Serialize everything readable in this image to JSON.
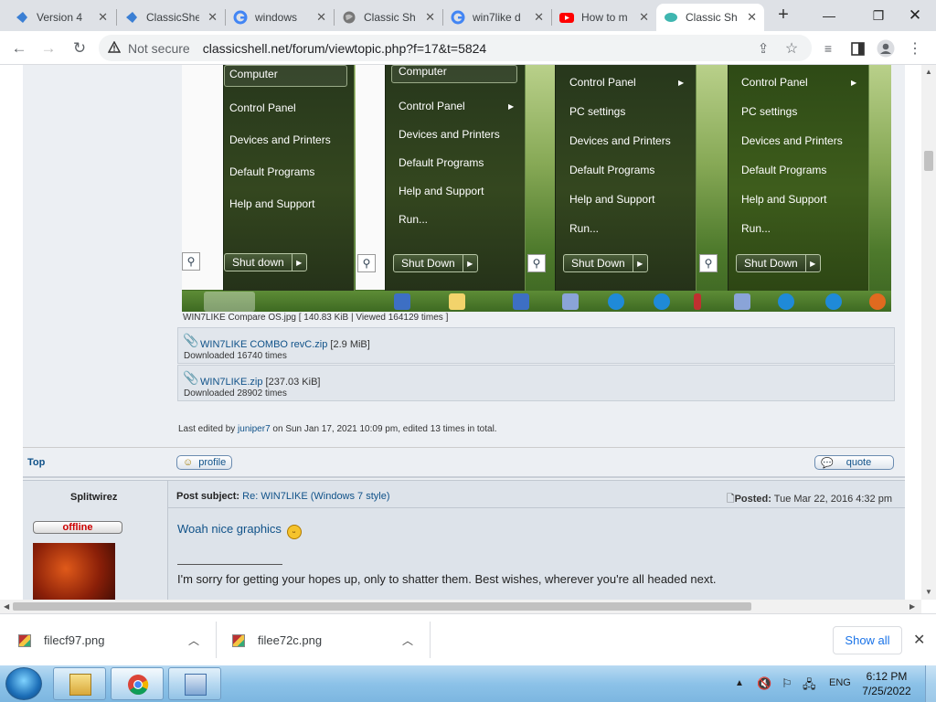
{
  "browser": {
    "tabs": [
      {
        "title": "Version 4",
        "icon": "classicshell-icon",
        "color": "#3b7fd4"
      },
      {
        "title": "ClassicShe",
        "icon": "classicshell-icon",
        "color": "#3b7fd4"
      },
      {
        "title": "windows",
        "icon": "google-icon",
        "color": "#4285f4"
      },
      {
        "title": "Classic Sh",
        "icon": "globe-icon",
        "color": "#666666"
      },
      {
        "title": "win7like d",
        "icon": "google-icon",
        "color": "#4285f4"
      },
      {
        "title": "How to m",
        "icon": "youtube-icon",
        "color": "#ff0000"
      },
      {
        "title": "Classic Sh",
        "icon": "classicshell-icon",
        "color": "#3fb6b0"
      }
    ],
    "security": "Not secure",
    "url": "classicshell.net/forum/viewtopic.php?f=17&t=5824"
  },
  "screenshot": {
    "menus": [
      {
        "items": [
          "Computer",
          "Control Panel",
          "Devices and Printers",
          "Default Programs",
          "Help and Support"
        ],
        "shutdown": "Shut down"
      },
      {
        "items": [
          "Computer",
          "Control Panel",
          "Devices and Printers",
          "Default Programs",
          "Help and Support",
          "Run..."
        ],
        "shutdown": "Shut Down"
      },
      {
        "items": [
          "Control Panel",
          "PC settings",
          "Devices and Printers",
          "Default Programs",
          "Help and Support",
          "Run..."
        ],
        "shutdown": "Shut Down"
      },
      {
        "items": [
          "Control Panel",
          "PC settings",
          "Devices and Printers",
          "Default Programs",
          "Help and Support",
          "Run..."
        ],
        "shutdown": "Shut Down"
      }
    ],
    "caption": "WIN7LIKE Compare OS.jpg [ 140.83 KiB | Viewed 164129 times ]"
  },
  "attachments": [
    {
      "name": "WIN7LIKE COMBO revC.zip",
      "size": "[2.9 MiB]",
      "downloads": "Downloaded 16740 times"
    },
    {
      "name": "WIN7LIKE.zip",
      "size": "[237.03 KiB]",
      "downloads": "Downloaded 28902 times"
    }
  ],
  "last_edit": {
    "prefix": "Last edited by",
    "user": "juniper7",
    "suffix": "on Sun Jan 17, 2021 10:09 pm, edited 13 times in total."
  },
  "post_footer": {
    "top": "Top",
    "profile": "profile",
    "quote": "quote"
  },
  "post2": {
    "author": "Splitwirez",
    "status": "offline",
    "subject_label": "Post subject:",
    "subject": "Re: WIN7LIKE (Windows 7 style)",
    "posted_label": "Posted:",
    "posted": "Tue Mar 22, 2016 4:32 pm",
    "body": "Woah nice graphics",
    "signature": "I'm sorry for getting your hopes up, only to shatter them. Best wishes, wherever you're all headed next."
  },
  "downloads": {
    "items": [
      "filecf97.png",
      "filee72c.png"
    ],
    "show_all": "Show all"
  },
  "taskbar": {
    "language": "ENG",
    "time": "6:12 PM",
    "date": "7/25/2022"
  }
}
